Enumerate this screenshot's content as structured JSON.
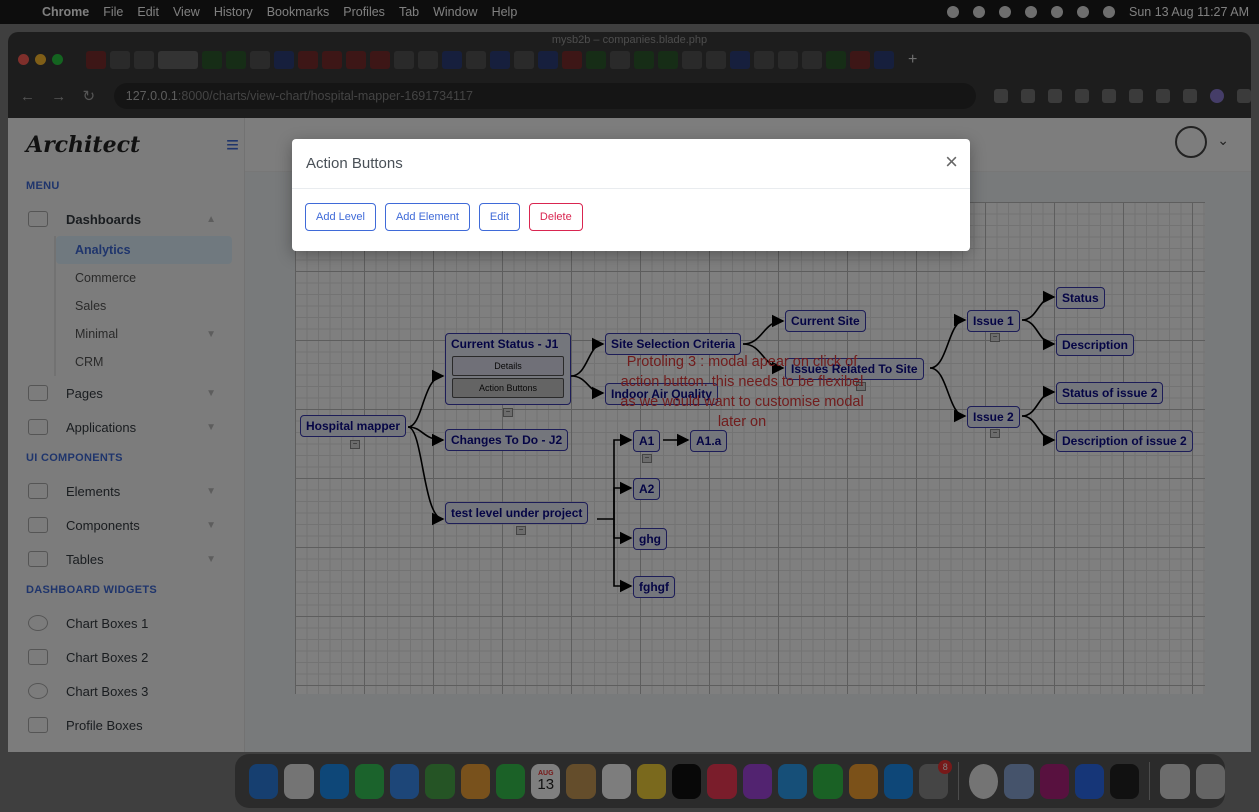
{
  "menubar": {
    "app": "Chrome",
    "items": [
      "File",
      "Edit",
      "View",
      "History",
      "Bookmarks",
      "Profiles",
      "Tab",
      "Window",
      "Help"
    ],
    "clock": "Sun 13 Aug  11:27 AM"
  },
  "browser": {
    "window_title": "mysb2b – companies.blade.php",
    "url_host": "127.0.0.1",
    "url_path": ":8000/charts/view-chart/hospital-mapper-1691734117"
  },
  "app": {
    "logo": "Architect",
    "sidebar": {
      "menu_heading": "MENU",
      "dashboards": "Dashboards",
      "dashboard_items": [
        "Analytics",
        "Commerce",
        "Sales",
        "Minimal",
        "CRM"
      ],
      "pages": "Pages",
      "applications": "Applications",
      "ui_heading": "UI COMPONENTS",
      "elements": "Elements",
      "components": "Components",
      "tables": "Tables",
      "widgets_heading": "DASHBOARD WIDGETS",
      "chart_boxes_1": "Chart Boxes 1",
      "chart_boxes_2": "Chart Boxes 2",
      "chart_boxes_3": "Chart Boxes 3",
      "profile_boxes": "Profile Boxes"
    }
  },
  "chart": {
    "root": "Hospital mapper",
    "current_status": "Current Status - J1",
    "details_btn": "Details",
    "action_btn": "Action Buttons",
    "changes": "Changes To Do - J2",
    "test_level": "test level under project",
    "site_selection": "Site Selection Criteria",
    "indoor_air": "Indoor Air Quality",
    "current_site": "Current Site",
    "issues_site": "Issues Related To Site",
    "issue1": "Issue 1",
    "issue2": "Issue 2",
    "status": "Status",
    "description": "Description",
    "status2": "Status of issue 2",
    "description2": "Description of issue 2",
    "a1": "A1",
    "a1a": "A1.a",
    "a2": "A2",
    "ghg": "ghg",
    "fghgf": "fghgf",
    "collapse": "−",
    "note": "Protoling 3 : modal apear on click of action button. this needs to be flexibel as we would want to customise modal later on"
  },
  "modal": {
    "title": "Action Buttons",
    "close": "×",
    "buttons": {
      "add_level": "Add Level",
      "add_element": "Add Element",
      "edit": "Edit",
      "delete": "Delete"
    }
  },
  "dock": {
    "calendar_month": "AUG",
    "calendar_day": "13",
    "badge": "8"
  }
}
